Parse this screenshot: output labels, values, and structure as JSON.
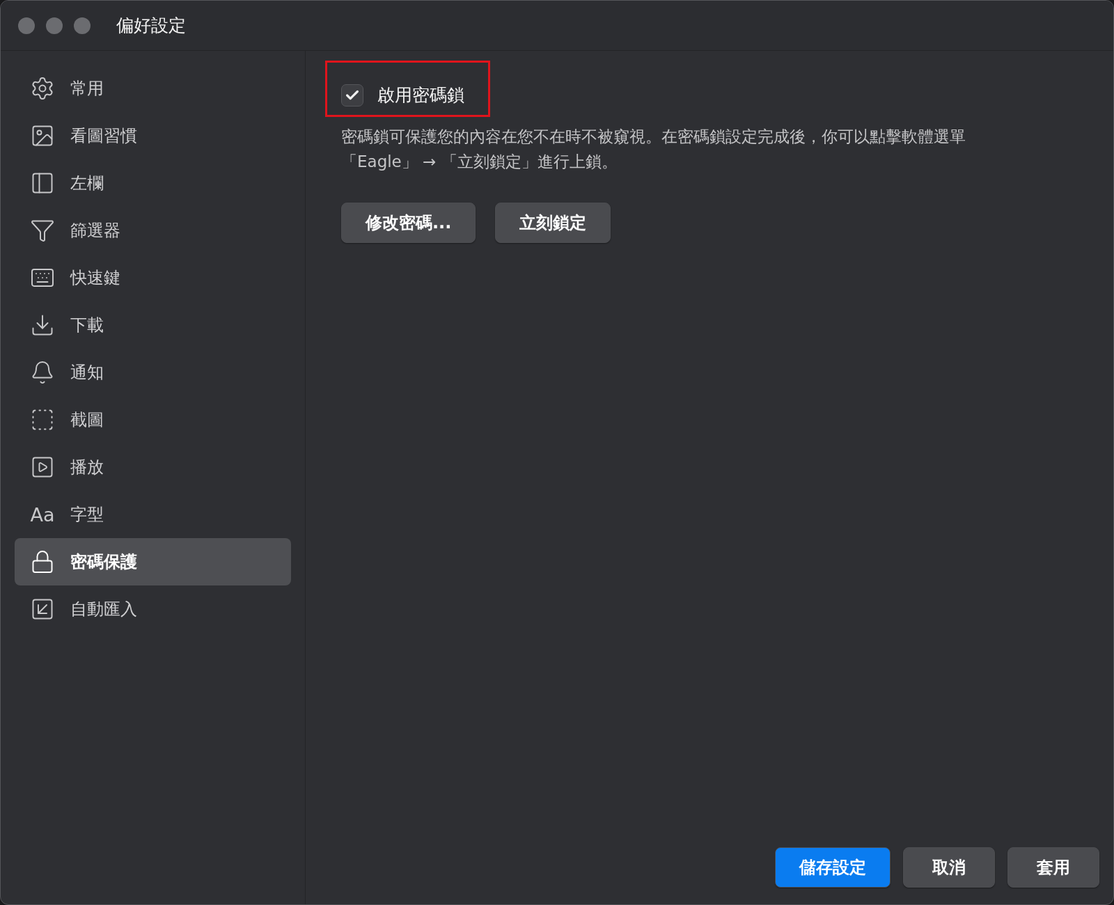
{
  "window": {
    "title": "偏好設定"
  },
  "sidebar": {
    "items": [
      {
        "label": "常用",
        "selected": false
      },
      {
        "label": "看圖習慣",
        "selected": false
      },
      {
        "label": "左欄",
        "selected": false
      },
      {
        "label": "篩選器",
        "selected": false
      },
      {
        "label": "快速鍵",
        "selected": false
      },
      {
        "label": "下載",
        "selected": false
      },
      {
        "label": "通知",
        "selected": false
      },
      {
        "label": "截圖",
        "selected": false
      },
      {
        "label": "播放",
        "selected": false
      },
      {
        "label": "字型",
        "selected": false,
        "glyph": "Aa"
      },
      {
        "label": "密碼保護",
        "selected": true
      },
      {
        "label": "自動匯入",
        "selected": false
      }
    ]
  },
  "content": {
    "checkbox": {
      "label": "啟用密碼鎖",
      "checked": true,
      "highlighted": true
    },
    "description": "密碼鎖可保護您的內容在您不在時不被窺視。在密碼鎖設定完成後，你可以點擊軟體選單「Eagle」 → 「立刻鎖定」進行上鎖。",
    "buttons": [
      "修改密碼...",
      "立刻鎖定"
    ]
  },
  "footer": {
    "buttons": [
      {
        "label": "儲存設定",
        "primary": true
      },
      {
        "label": "取消",
        "primary": false
      },
      {
        "label": "套用",
        "primary": false
      }
    ]
  }
}
